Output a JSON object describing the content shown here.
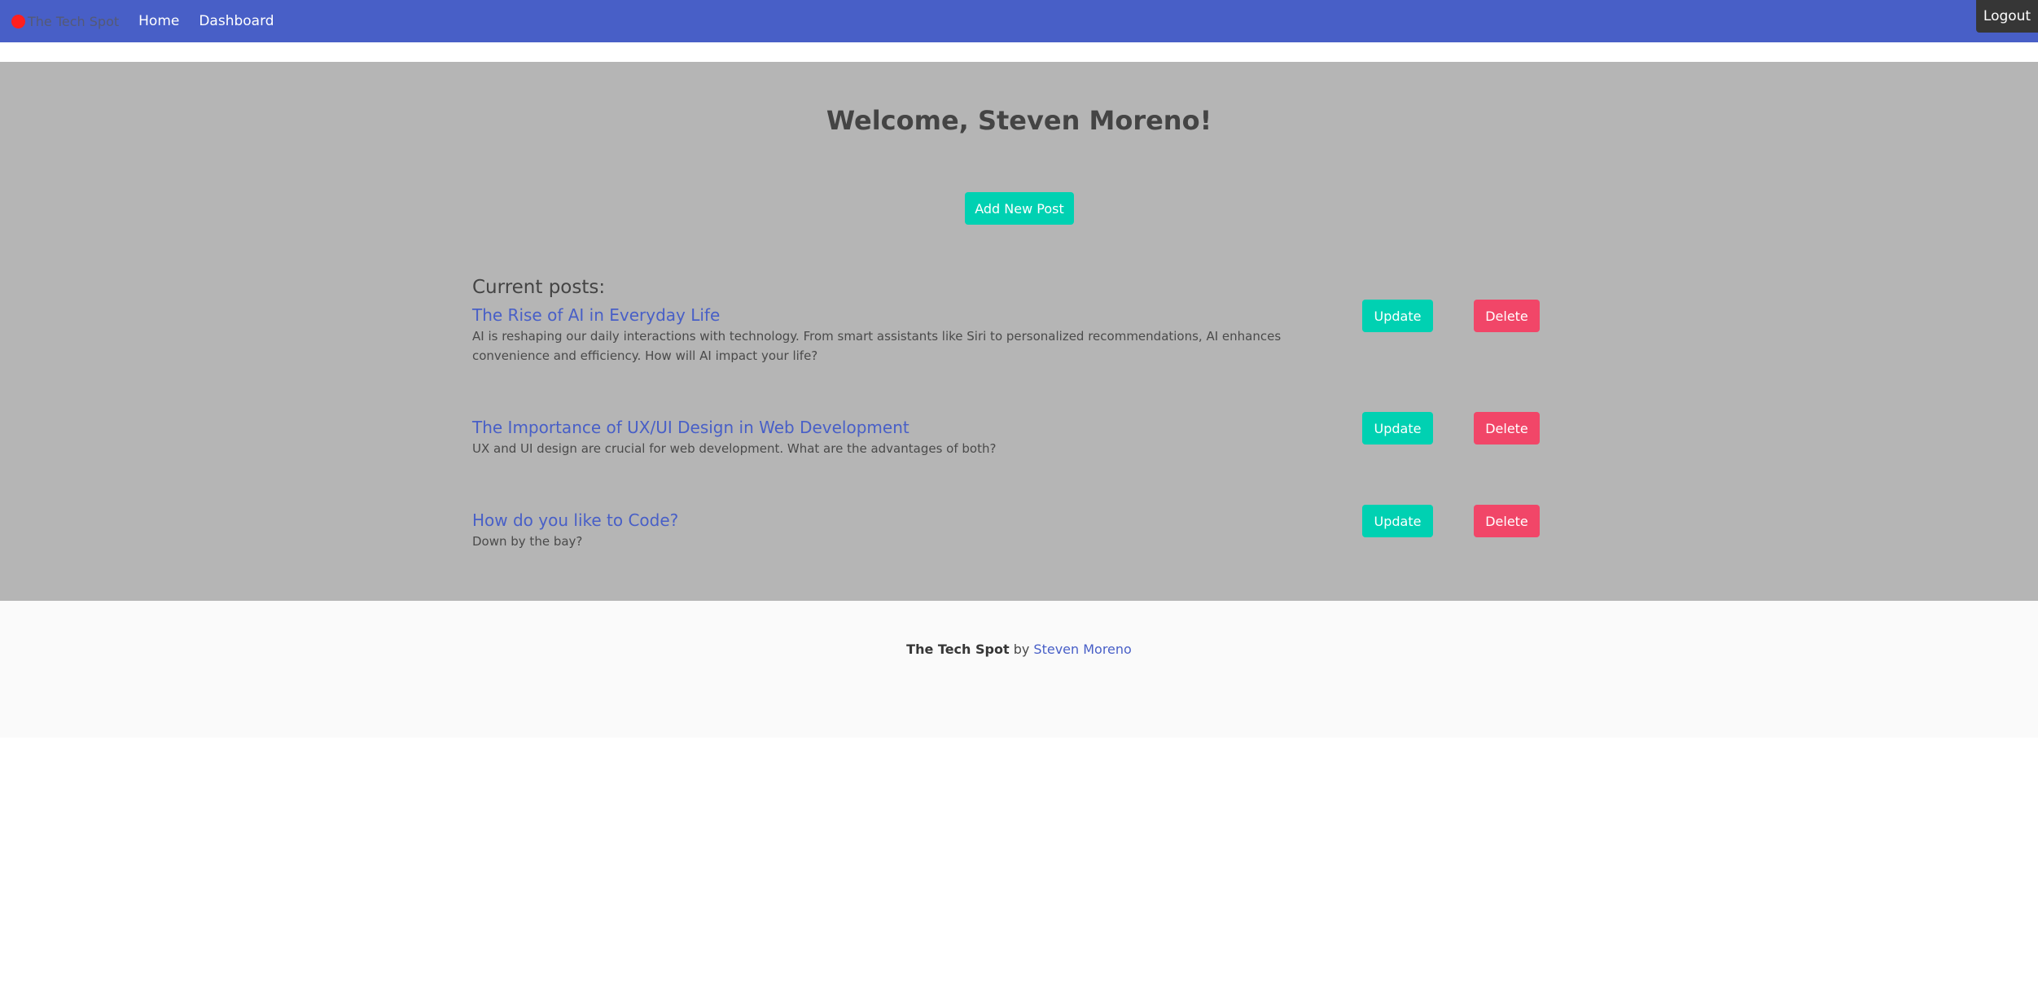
{
  "navbar": {
    "brand": "The Tech Spot",
    "links": [
      "Home",
      "Dashboard"
    ],
    "logout_label": "Logout"
  },
  "main": {
    "welcome": "Welcome, Steven Moreno!",
    "add_post_label": "Add New Post",
    "posts_heading": "Current posts:",
    "posts": [
      {
        "title": "The Rise of AI in Everyday Life",
        "body": "AI is reshaping our daily interactions with technology. From smart assistants like Siri to personalized recommendations, AI enhances convenience and efficiency. How will AI impact your life?",
        "update_label": "Update",
        "delete_label": "Delete"
      },
      {
        "title": "The Importance of UX/UI Design in Web Development",
        "body": "UX and UI design are crucial for web development. What are the advantages of both?",
        "update_label": "Update",
        "delete_label": "Delete"
      },
      {
        "title": "How do you like to Code?",
        "body": "Down by the bay?",
        "update_label": "Update",
        "delete_label": "Delete"
      }
    ]
  },
  "footer": {
    "brand": "The Tech Spot",
    "by": "by",
    "author": "Steven Moreno"
  },
  "colors": {
    "navbar": "#485fc7",
    "main_bg": "#b5b5b5",
    "primary": "#00d1b2",
    "danger": "#f14668",
    "link": "#485fc7"
  },
  "icons": {
    "brand": "red-circle-logo-icon"
  }
}
